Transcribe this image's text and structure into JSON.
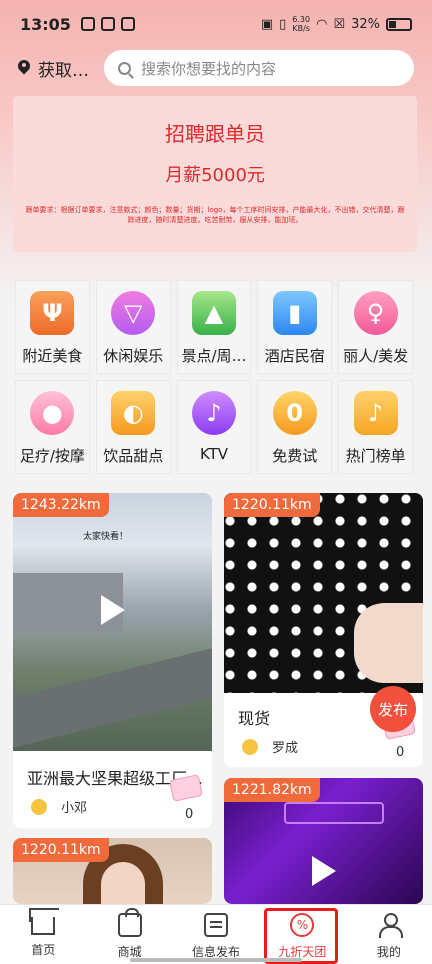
{
  "status_bar": {
    "time": "13:05",
    "net_speed_top": "6.30",
    "net_speed_bottom": "KB/s",
    "battery": "32%"
  },
  "header": {
    "location_label": "获取…",
    "search_placeholder": "搜索你想要找的内容"
  },
  "banner": {
    "title": "招聘跟单员",
    "salary": "月薪5000元",
    "description": "跟单要求：根据订单要求，注意款式；颜色；数量；货期；logo，每个工序时间安排，产能最大化，不出错，交代清楚，跟踪进度，随时清楚进度。吃苦耐劳，服从安排，能加班。"
  },
  "categories": [
    {
      "label": "附近美食",
      "icon": "food-icon",
      "glyph": "Ψ"
    },
    {
      "label": "休闲娱乐",
      "icon": "cocktail-icon",
      "glyph": "▽"
    },
    {
      "label": "景点/周…",
      "icon": "mountain-icon",
      "glyph": "▲"
    },
    {
      "label": "酒店民宿",
      "icon": "hotel-icon",
      "glyph": "▮"
    },
    {
      "label": "丽人/美发",
      "icon": "beauty-icon",
      "glyph": "♀"
    },
    {
      "label": "足疗/按摩",
      "icon": "foot-icon",
      "glyph": "●"
    },
    {
      "label": "饮品甜点",
      "icon": "drink-icon",
      "glyph": "◐"
    },
    {
      "label": "KTV",
      "icon": "microphone-icon",
      "glyph": "♪"
    },
    {
      "label": "免费试",
      "icon": "free-coin-icon",
      "glyph": "0"
    },
    {
      "label": "热门榜单",
      "icon": "ranking-icon",
      "glyph": "♪"
    }
  ],
  "feed": [
    {
      "distance": "1243.22km",
      "title": "亚洲最大坚果超级工厂…",
      "user": "小邓",
      "count": "0",
      "video_caption": "太家快看！"
    },
    {
      "distance": "1220.11km",
      "title": "现货",
      "user": "罗成",
      "count": "0"
    },
    {
      "distance": "1221.82km"
    },
    {
      "distance": "1220.11km"
    }
  ],
  "publish_button": "发布",
  "bottom_nav": [
    {
      "label": "首页",
      "icon": "home-icon"
    },
    {
      "label": "商城",
      "icon": "shopping-bag-icon"
    },
    {
      "label": "信息发布",
      "icon": "message-icon"
    },
    {
      "label": "九折天团",
      "icon": "discount-icon",
      "glyph": "%"
    },
    {
      "label": "我的",
      "icon": "user-icon"
    }
  ],
  "colors": {
    "accent": "#f06a3c",
    "brand_red": "#e23b3b",
    "banner_bg": "#fbdada"
  }
}
